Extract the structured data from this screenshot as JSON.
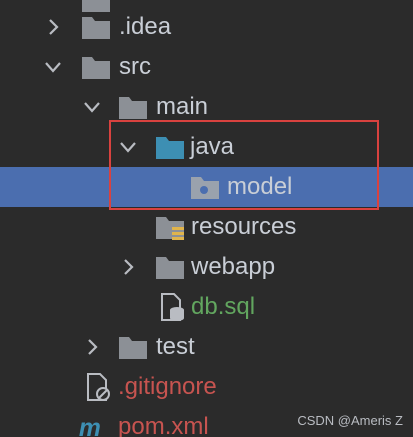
{
  "project_tree": {
    "items": [
      {
        "label": ".idea",
        "state": "collapsed"
      },
      {
        "label": "src",
        "state": "expanded"
      },
      {
        "label": "main",
        "state": "expanded"
      },
      {
        "label": "java",
        "state": "expanded",
        "icon": "source-folder-icon"
      },
      {
        "label": "model",
        "state": "leaf",
        "icon": "package-icon",
        "selected": true
      },
      {
        "label": "resources",
        "state": "leaf",
        "icon": "resources-folder-icon"
      },
      {
        "label": "webapp",
        "state": "collapsed"
      },
      {
        "label": "db.sql",
        "state": "leaf",
        "icon": "sql-file-icon",
        "color": "#62a65f"
      },
      {
        "label": "test",
        "state": "collapsed"
      },
      {
        "label": ".gitignore",
        "state": "leaf",
        "icon": "ignored-file-icon",
        "color": "#c75450"
      },
      {
        "label": "pom.xml",
        "state": "leaf",
        "icon": "maven-icon",
        "color": "#c75450"
      }
    ]
  },
  "colors": {
    "background": "#2b2b2b",
    "selection": "#4b6eaf",
    "folder": "#8c9096",
    "source_folder": "#3d8fb3",
    "highlight_box": "#d9423f"
  },
  "watermark": "CSDN @Ameris Z"
}
